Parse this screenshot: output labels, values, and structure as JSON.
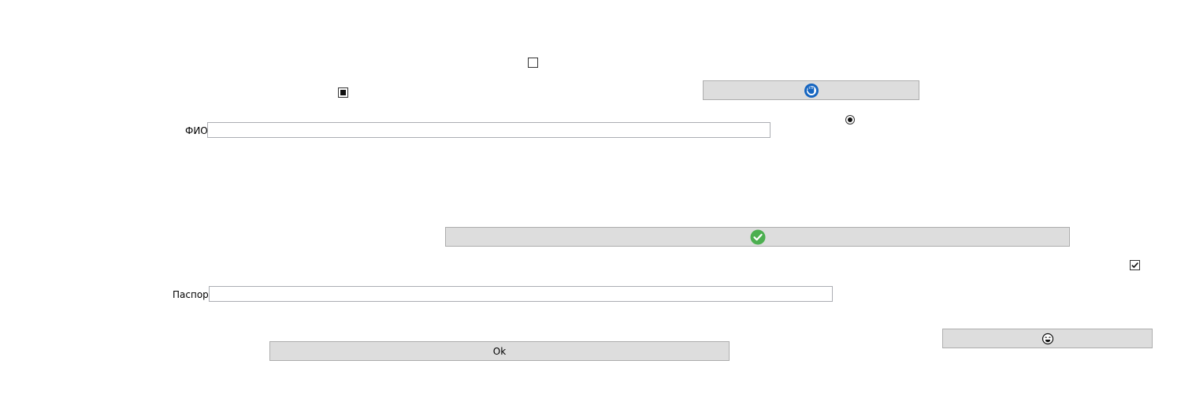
{
  "window": {
    "background": "#ffffff"
  },
  "buttons": {
    "ok_label": "Ok",
    "icon_button_1_icon": "blue-circle-hand-icon",
    "icon_button_2_icon": "green-checkmark-icon",
    "icon_button_3_icon": "face-emoji-icon"
  },
  "fields": {
    "fio": {
      "label": "ФИО",
      "value": ""
    },
    "passport": {
      "label": "Паспорт",
      "value": ""
    }
  },
  "checkboxes": {
    "top": {
      "state": "unchecked"
    },
    "left": {
      "state": "indeterminate"
    },
    "right": {
      "state": "checked"
    }
  },
  "radio": {
    "state": "selected"
  },
  "colors": {
    "button_face": "#dddddd",
    "button_border": "#adadad",
    "icon_blue": "#1565c0",
    "icon_green": "#4caf50"
  }
}
